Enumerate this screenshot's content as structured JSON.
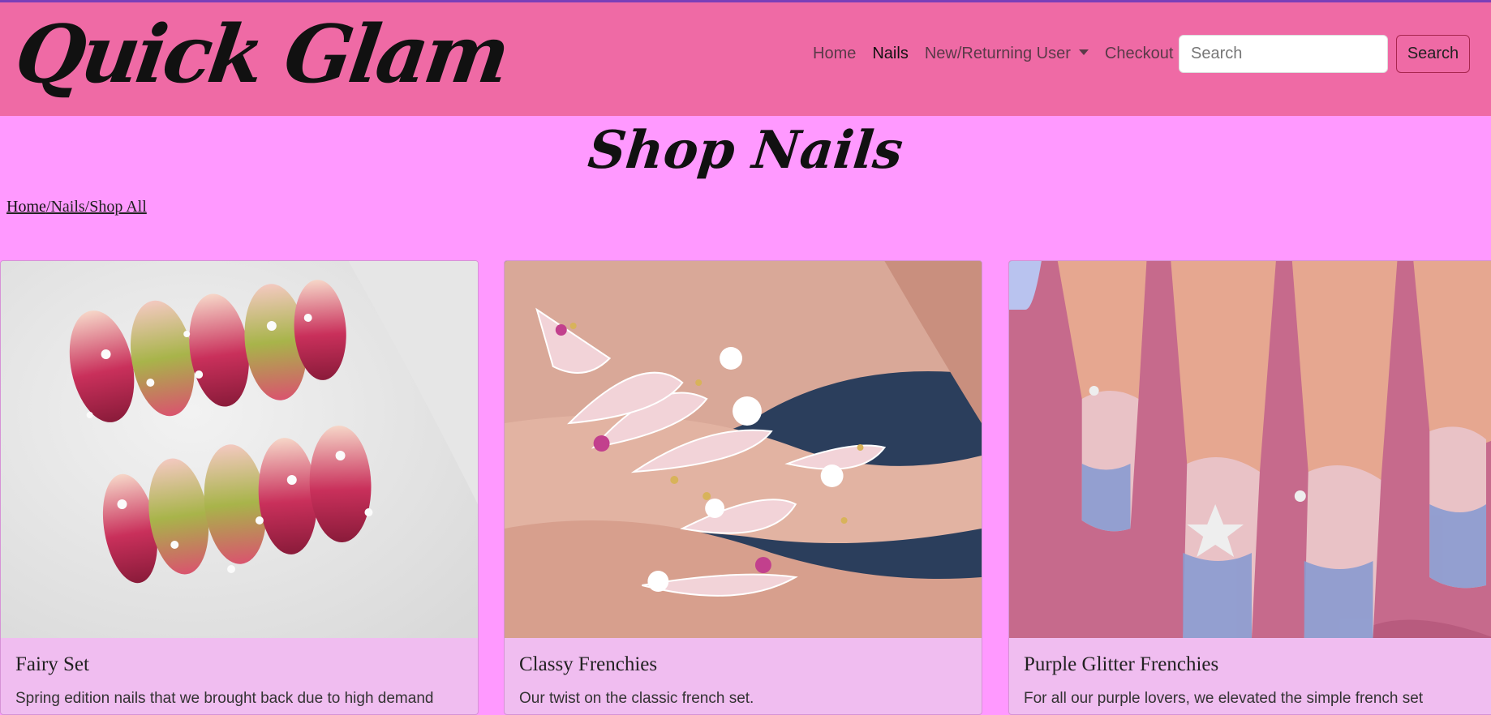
{
  "brand": {
    "logo_text": "Quick Glam"
  },
  "nav": {
    "items": [
      {
        "label": "Home",
        "active": false
      },
      {
        "label": "Nails",
        "active": true
      },
      {
        "label": "New/Returning User",
        "dropdown": true
      },
      {
        "label": "Checkout",
        "active": false
      }
    ],
    "search": {
      "placeholder": "Search",
      "button_label": "Search"
    }
  },
  "page": {
    "title": "Shop Nails",
    "breadcrumb": [
      "Home",
      "/Nails/Shop All"
    ]
  },
  "products": [
    {
      "title": "Fairy Set",
      "description": "Spring edition nails that we brought back due to high demand"
    },
    {
      "title": "Classy Frenchies",
      "description": "Our twist on the classic french set."
    },
    {
      "title": "Purple Glitter Frenchies",
      "description": "For all our purple lovers, we elevated the simple french set"
    }
  ],
  "colors": {
    "navbar": "#ef6aa5",
    "page_bg": "#ff99ff",
    "card_bg": "#f0bdf0",
    "search_border": "#a8264f"
  }
}
